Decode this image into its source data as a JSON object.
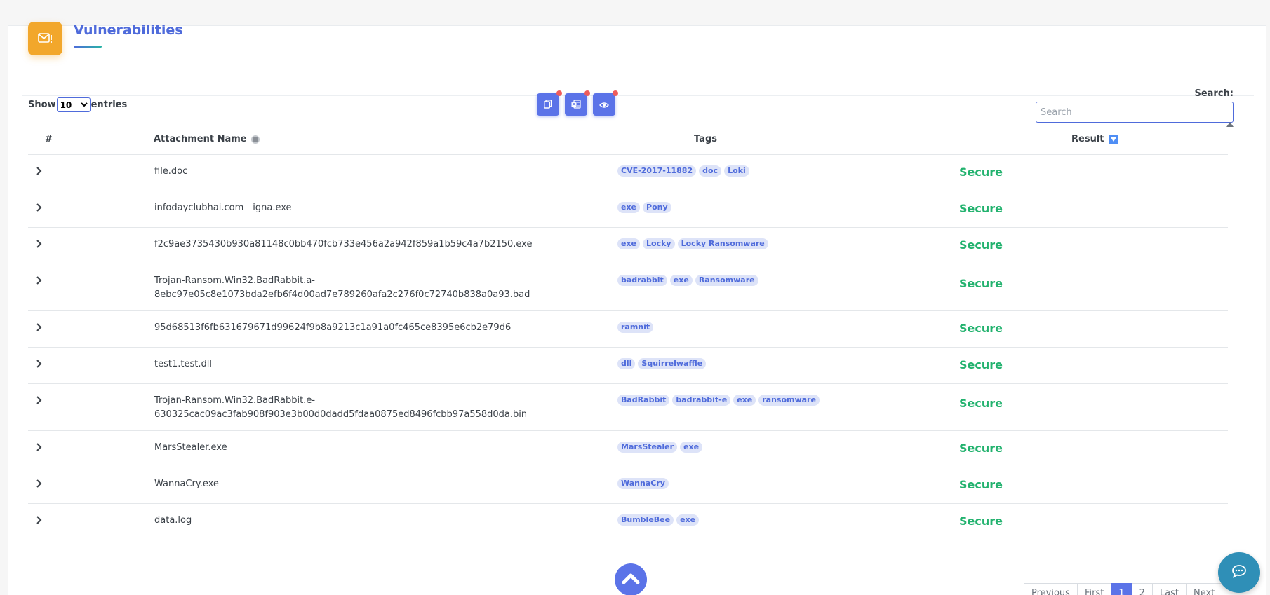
{
  "header": {
    "title": "Vulnerabilities",
    "icon": "mail-alert-icon",
    "icon_color": "#f2a72b"
  },
  "controls": {
    "show_label": "Show",
    "entries_label": "entries",
    "page_size_options": [
      "10"
    ],
    "page_size": "10",
    "search_label": "Search:",
    "search_placeholder": "Search",
    "toolbar": [
      {
        "name": "copy-icon"
      },
      {
        "name": "excel-icon"
      },
      {
        "name": "eye-icon"
      }
    ]
  },
  "table": {
    "columns": [
      "#",
      "Attachment Name",
      "Tags",
      "Result"
    ],
    "rows": [
      {
        "name": "file.doc",
        "tags": [
          "CVE-2017-11882",
          "doc",
          "Loki"
        ],
        "result": "Secure"
      },
      {
        "name": "infodayclubhai.com__igna.exe",
        "tags": [
          "exe",
          "Pony"
        ],
        "result": "Secure"
      },
      {
        "name": "f2c9ae3735430b930a81148c0bb470fcb733e456a2a942f859a1b59c4a7b2150.exe",
        "tags": [
          "exe",
          "Locky",
          "Locky Ransomware"
        ],
        "result": "Secure"
      },
      {
        "name": "Trojan-Ransom.Win32.BadRabbit.a-",
        "name2": "8ebc97e05c8e1073bda2efb6f4d00ad7e789260afa2c276f0c72740b838a0a93.bad",
        "tags": [
          "badrabbit",
          "exe",
          "Ransomware"
        ],
        "result": "Secure"
      },
      {
        "name": "95d68513f6fb631679671d99624f9b8a9213c1a91a0fc465ce8395e6cb2e79d6",
        "tags": [
          "ramnit"
        ],
        "result": "Secure"
      },
      {
        "name": "test1.test.dll",
        "tags": [
          "dll",
          "Squirrelwaffle"
        ],
        "result": "Secure"
      },
      {
        "name": "Trojan-Ransom.Win32.BadRabbit.e-",
        "name2": "630325cac09ac3fab908f903e3b00d0dadd5fdaa0875ed8496fcbb97a558d0da.bin",
        "tags": [
          "BadRabbit",
          "badrabbit-e",
          "exe",
          "ransomware"
        ],
        "result": "Secure"
      },
      {
        "name": "MarsStealer.exe",
        "tags": [
          "MarsStealer",
          "exe"
        ],
        "result": "Secure"
      },
      {
        "name": "WannaCry.exe",
        "tags": [
          "WannaCry"
        ],
        "result": "Secure"
      },
      {
        "name": "data.log",
        "tags": [
          "BumbleBee",
          "exe"
        ],
        "result": "Secure"
      }
    ]
  },
  "pagination": {
    "buttons": [
      "Previous",
      "First",
      "1",
      "2",
      "Last",
      "Next"
    ],
    "active": "1"
  },
  "colors": {
    "accent": "#5b73e8",
    "secure": "#22b26e",
    "title": "#4f6bdb"
  }
}
